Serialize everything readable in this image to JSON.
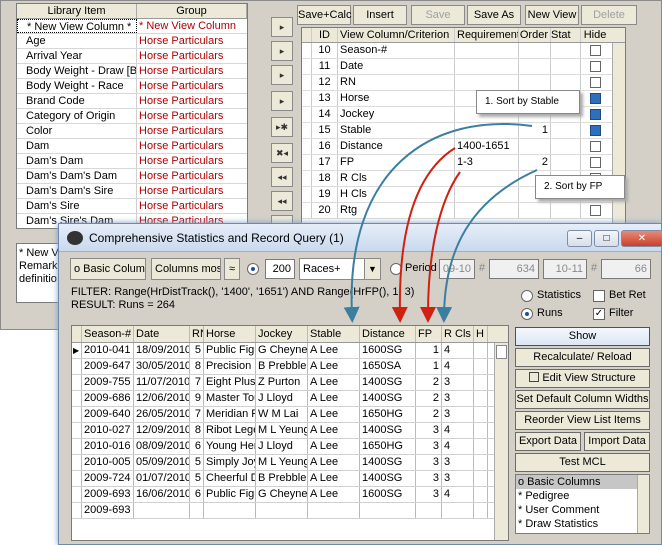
{
  "library": {
    "headers": [
      "Library Item",
      "Group"
    ],
    "rows": [
      [
        "* New View Column *",
        "* New View Column"
      ],
      [
        "Age",
        "Horse Particulars"
      ],
      [
        "Arrival Year",
        "Horse Particulars"
      ],
      [
        "Body Weight - Draw [B W",
        "Horse Particulars"
      ],
      [
        "Body Weight - Race",
        "Horse Particulars"
      ],
      [
        "Brand Code",
        "Horse Particulars"
      ],
      [
        "Category of Origin",
        "Horse Particulars"
      ],
      [
        "Color",
        "Horse Particulars"
      ],
      [
        "Dam",
        "Horse Particulars"
      ],
      [
        "Dam's Dam",
        "Horse Particulars"
      ],
      [
        "Dam's Dam's Dam",
        "Horse Particulars"
      ],
      [
        "Dam's Dam's Sire",
        "Horse Particulars"
      ],
      [
        "Dam's Sire",
        "Horse Particulars"
      ],
      [
        "Dam's Sire's Dam",
        "Horse Particulars"
      ]
    ],
    "remark_lines": [
      "* New Vi",
      "Remark:",
      "definitio"
    ]
  },
  "middle_buttons": [
    "▸",
    "▸",
    "▸",
    "▸",
    "▸✱",
    "✖◂",
    "◂◂",
    "◂◂",
    "▸"
  ],
  "toolbar": {
    "save_calc": "Save+Calc",
    "insert_view": "Insert View",
    "save": "Save",
    "save_as": "Save As",
    "new_view": "New View",
    "delete_view": "Delete View"
  },
  "view_grid": {
    "headers": [
      "ID",
      "View Column/Criterion",
      "Requirement",
      "Order",
      "Stat",
      "Hide"
    ],
    "rows": [
      {
        "id": "10",
        "name": "Season-#",
        "req": "",
        "order": "",
        "hide": false
      },
      {
        "id": "11",
        "name": "Date",
        "req": "",
        "order": "",
        "hide": false
      },
      {
        "id": "12",
        "name": "RN",
        "req": "",
        "order": "",
        "hide": false
      },
      {
        "id": "13",
        "name": "Horse",
        "req": "",
        "order": "",
        "hide": true
      },
      {
        "id": "14",
        "name": "Jockey",
        "req": "",
        "order": "",
        "hide": true
      },
      {
        "id": "15",
        "name": "Stable",
        "req": "",
        "order": "1",
        "hide": true
      },
      {
        "id": "16",
        "name": "Distance",
        "req": "1400-1651",
        "order": "",
        "hide": false
      },
      {
        "id": "17",
        "name": "FP",
        "req": "1-3",
        "order": "2",
        "hide": false
      },
      {
        "id": "18",
        "name": "R Cls",
        "req": "",
        "order": "",
        "hide": false
      },
      {
        "id": "19",
        "name": "H Cls",
        "req": "",
        "order": "",
        "hide": false
      },
      {
        "id": "20",
        "name": "Rtg",
        "req": "",
        "order": "",
        "hide": false
      }
    ]
  },
  "callouts": [
    "1. Sort by Stable",
    "2. Sort by FP"
  ],
  "colors": {
    "arrow_blue": "#3a7fa0",
    "arrow_red": "#d02010",
    "hide_checked": "#2f6fbf"
  },
  "query_window": {
    "title": "Comprehensive Statistics and Record Query (1)",
    "window_buttons": [
      "–",
      "□",
      "✕"
    ],
    "view_select": "o Basic Colum",
    "columns_select": "Columns mos",
    "equals_btn": "≈",
    "runs_count": "200",
    "races_select": "Races+",
    "period_label": "Period",
    "period_from": "09-10",
    "period_n1": "634",
    "period_to": "10-11",
    "period_n2": "66",
    "filter_text": "FILTER: Range(HrDistTrack(), '1400', '1651') AND Range(HrFP(), 1, 3)",
    "result_text": "RESULT: Runs = 264",
    "radio_statistics": "Statistics",
    "radio_runs": "Runs",
    "chk_bet_ret": "Bet Ret",
    "chk_filter": "Filter",
    "result_headers": [
      "Season-#",
      "Date",
      "RN",
      "Horse",
      "Jockey",
      "Stable",
      "Distance",
      "FP",
      "R Cls",
      "H"
    ],
    "result_rows": [
      [
        "2010-041",
        "18/09/2010",
        "5",
        "Public Figu",
        "G Cheyne",
        "A Lee",
        "1600SG",
        "1",
        "4"
      ],
      [
        "2009-647",
        "30/05/2010",
        "8",
        "Precision M",
        "B Prebble",
        "A Lee",
        "1650SA",
        "1",
        "4"
      ],
      [
        "2009-755",
        "11/07/2010",
        "7",
        "Eight Plus E",
        "Z Purton",
        "A Lee",
        "1400SG",
        "2",
        "3"
      ],
      [
        "2009-686",
        "12/06/2010",
        "9",
        "Master Tou",
        "J Lloyd",
        "A Lee",
        "1400SG",
        "2",
        "3"
      ],
      [
        "2009-640",
        "26/05/2010",
        "7",
        "Meridian P",
        "W M Lai",
        "A Lee",
        "1650HG",
        "2",
        "3"
      ],
      [
        "2010-027",
        "12/09/2010",
        "8",
        "Ribot Lege",
        "M L Yeung",
        "A Lee",
        "1400SG",
        "3",
        "4"
      ],
      [
        "2010-016",
        "08/09/2010",
        "6",
        "Young Her",
        "J Lloyd",
        "A Lee",
        "1650HG",
        "3",
        "4"
      ],
      [
        "2010-005",
        "05/09/2010",
        "5",
        "Simply Joy",
        "M L Yeung",
        "A Lee",
        "1400SG",
        "3",
        "3"
      ],
      [
        "2009-724",
        "01/07/2010",
        "5",
        "Cheerful D",
        "B Prebble",
        "A Lee",
        "1400SG",
        "3",
        "3"
      ],
      [
        "2009-693",
        "16/06/2010",
        "6",
        "Public Figu",
        "G Cheyne",
        "A Lee",
        "1600SG",
        "3",
        "4"
      ],
      [
        "2009-693",
        "",
        "",
        "",
        "",
        "",
        "",
        "",
        ""
      ]
    ],
    "right_buttons": [
      "Show",
      "Recalculate/ Reload",
      "Edit View Structure",
      "Set Default Column Widths",
      "Reorder View List Items",
      "Export Data",
      "Import Data",
      "Test MCL"
    ],
    "right_list": [
      "o Basic Columns",
      "* Pedigree",
      "* User Comment",
      "* Draw Statistics"
    ]
  }
}
